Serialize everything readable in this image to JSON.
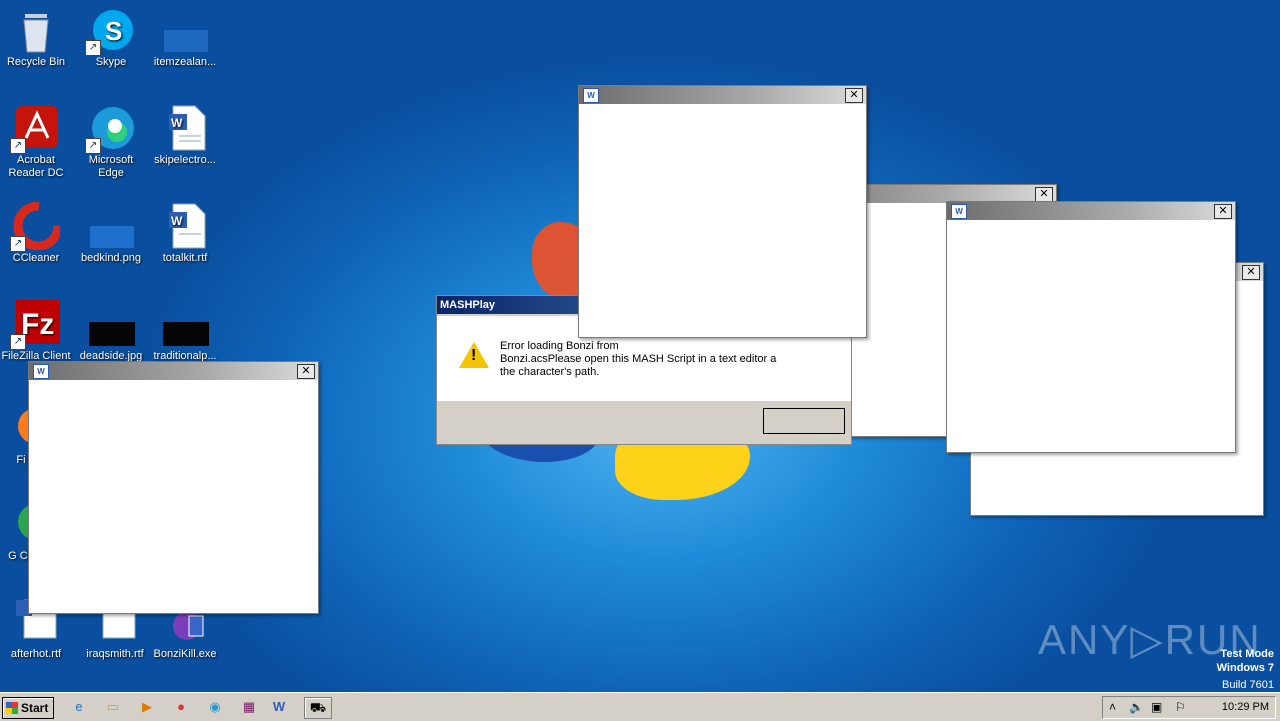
{
  "desktop_icons": [
    {
      "label": "Recycle Bin",
      "icon": "recycle-bin-icon"
    },
    {
      "label": "Skype",
      "icon": "skype-icon"
    },
    {
      "label": "itemzealan...",
      "icon": "image-file-icon"
    },
    {
      "label": "Acrobat Reader DC",
      "icon": "acrobat-icon"
    },
    {
      "label": "Microsoft Edge",
      "icon": "edge-icon"
    },
    {
      "label": "skipelectro...",
      "icon": "word-doc-icon"
    },
    {
      "label": "CCleaner",
      "icon": "ccleaner-icon"
    },
    {
      "label": "bedkind.png",
      "icon": "image-file-icon"
    },
    {
      "label": "totalkit.rtf",
      "icon": "word-doc-icon"
    },
    {
      "label": "FileZilla Client",
      "icon": "filezilla-icon"
    },
    {
      "label": "deadside.jpg",
      "icon": "image-file-icon"
    },
    {
      "label": "traditionalp...",
      "icon": "image-file-icon"
    },
    {
      "label": "Fi",
      "icon": "firefox-icon"
    },
    {
      "label": "G Ch",
      "icon": "chrome-icon"
    },
    {
      "label": "afterhot.rtf",
      "icon": "word-doc-icon"
    },
    {
      "label": "iraqsmith.rtf",
      "icon": "word-doc-icon"
    },
    {
      "label": "BonziKill.exe",
      "icon": "bonzi-icon"
    }
  ],
  "dialog": {
    "title": "MASHPlay",
    "message": "Error loading Bonzi from\nBonzi.acsPlease open this MASH Script in a text editor a\nthe character's path."
  },
  "windows": {
    "close_glyph": "✕",
    "app_icon_text": "W"
  },
  "taskbar": {
    "start_label": "Start",
    "clock": "10:29 PM",
    "pinned": [
      "ie-icon",
      "explorer-icon",
      "media-player-icon",
      "chrome-icon",
      "edge-icon",
      "winrar-icon",
      "word-icon",
      "bonzi-icon"
    ]
  },
  "watermark": {
    "line1": "Test Mode",
    "line2": "Windows 7",
    "line3": "Build 7601",
    "brand": "ANY▷RUN"
  }
}
